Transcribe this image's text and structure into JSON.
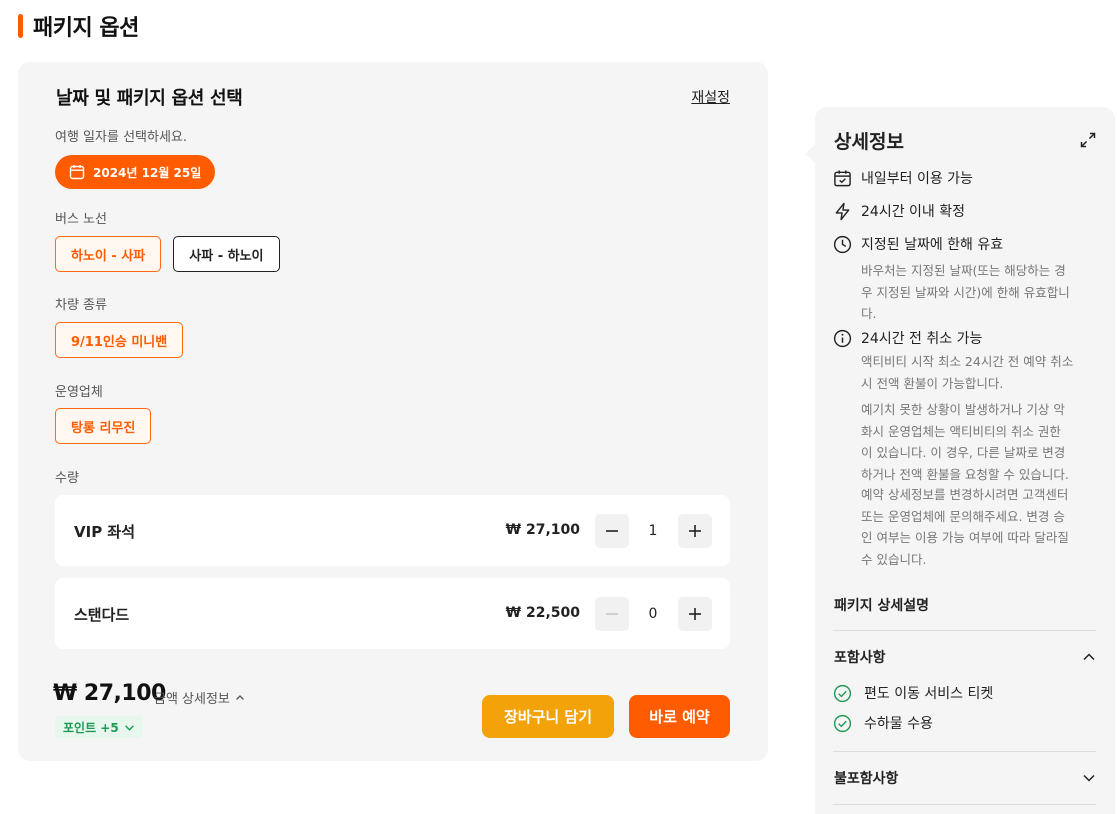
{
  "page": {
    "title": "패키지 옵션"
  },
  "colors": {
    "accent": "#ff5b00",
    "cart": "#f4a20a",
    "points_green": "#1e9a54",
    "panel_bg": "#f5f5f5"
  },
  "options_card": {
    "title": "날짜 및 패키지 옵션 선택",
    "reset_label": "재설정",
    "date": {
      "label": "여행 일자를 선택하세요.",
      "value": "2024년 12월 25일",
      "icon": "calendar-icon"
    },
    "bus_route": {
      "label": "버스 노선",
      "options": [
        "하노이 - 사파",
        "사파 - 하노이"
      ],
      "selected": "하노이 - 사파"
    },
    "vehicle": {
      "label": "차량 종류",
      "options": [
        "9/11인승 미니밴"
      ],
      "selected": "9/11인승 미니밴"
    },
    "operator": {
      "label": "운영업체",
      "options": [
        "탕롱 리무진"
      ],
      "selected": "탕롱 리무진"
    },
    "quantity": {
      "label": "수량",
      "items": [
        {
          "name": "VIP 좌석",
          "price": "₩ 27,100",
          "qty": "1"
        },
        {
          "name": "스탠다드",
          "price": "₩ 22,500",
          "qty": "0"
        }
      ]
    },
    "total": {
      "price": "₩ 27,100",
      "detail_label": "금액 상세정보",
      "points_label": "포인트 +5"
    },
    "buttons": {
      "cart": "장바구니 담기",
      "book": "바로 예약"
    }
  },
  "details_panel": {
    "title": "상세정보",
    "items": [
      {
        "icon": "calendar-check-icon",
        "text": "내일부터 이용 가능"
      },
      {
        "icon": "lightning-icon",
        "text": "24시간 이내 확정"
      },
      {
        "icon": "clock-icon",
        "text": "지정된 날짜에 한해 유효",
        "desc": [
          "바우처는 지정된 날짜(또는 해당하는 경",
          "우 지정된 날짜와 시간)에 한해 유효합니",
          "다."
        ]
      },
      {
        "icon": "info-icon",
        "text": "24시간 전 취소 가능",
        "desc": [
          "액티비티 시작 최소 24시간 전 예약 취소",
          "시 전액 환불이 가능합니다."
        ],
        "desc2": [
          "예기치 못한 상황이 발생하거나 기상 악",
          "화시 운영업체는 액티비티의 취소 권한",
          "이 있습니다. 이 경우, 다른 날짜로 변경",
          "하거나 전액 환불을 요청할 수 있습니다."
        ],
        "desc3": [
          "예약 상세정보를 변경하시려면 고객센터",
          "또는 운영업체에 문의해주세요. 변경 승",
          "인 여부는 이용 가능 여부에 따라 달라질",
          "수 있습니다."
        ]
      }
    ],
    "package_title": "패키지 상세설명",
    "included": {
      "label": "포함사항",
      "items": [
        "편도 이동 서비스 티켓",
        "수하물 수용"
      ]
    },
    "excluded": {
      "label": "불포함사항"
    }
  }
}
